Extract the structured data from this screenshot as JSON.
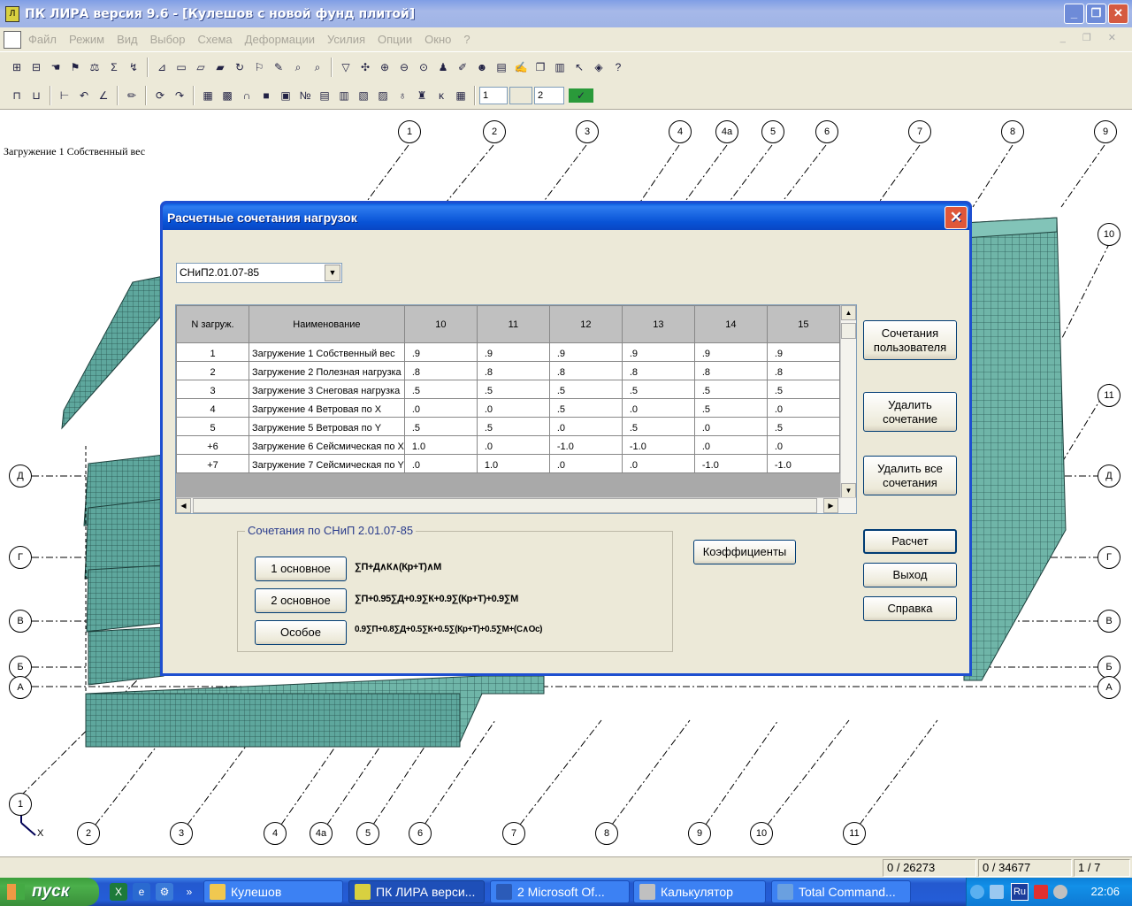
{
  "window": {
    "title": "ПК ЛИРА  версия 9.6 - [Кулешов с новой фунд плитой]",
    "min": "_",
    "max": "❐",
    "close": "✕"
  },
  "menu": {
    "items": [
      "Файл",
      "Режим",
      "Вид",
      "Выбор",
      "Схема",
      "Деформации",
      "Усилия",
      "Опции",
      "Окно",
      "?"
    ]
  },
  "toolbar": {
    "spin_value": "1",
    "spin_value2": "",
    "spin_value3": "2"
  },
  "canvas": {
    "loadcase_label": "Загружение  1 Собственный вес",
    "top_axes": [
      "1",
      "2",
      "3",
      "4",
      "4а",
      "5",
      "6",
      "7",
      "8",
      "9"
    ],
    "bottom_axes": [
      "1",
      "2",
      "3",
      "4",
      "4а",
      "5",
      "6",
      "7",
      "8",
      "9",
      "10",
      "11"
    ],
    "left_axes": [
      "Д",
      "Г",
      "В",
      "Б",
      "А"
    ],
    "right_axes": [
      "10",
      "11",
      "Д",
      "Г",
      "В",
      "Б",
      "А"
    ],
    "x_label": "X"
  },
  "dialog": {
    "title": "Расчетные сочетания нагрузок",
    "norm_select": "СНиП2.01.07-85",
    "columns": [
      "N загруж.",
      "Наименование",
      "10",
      "11",
      "12",
      "13",
      "14",
      "15"
    ],
    "rows": [
      [
        "1",
        "Загружение  1 Собственный вес",
        ".9",
        ".9",
        ".9",
        ".9",
        ".9",
        ".9"
      ],
      [
        "2",
        "Загружение  2 Полезная нагрузка",
        ".8",
        ".8",
        ".8",
        ".8",
        ".8",
        ".8"
      ],
      [
        "3",
        "Загружение  3 Снеговая нагрузка",
        ".5",
        ".5",
        ".5",
        ".5",
        ".5",
        ".5"
      ],
      [
        "4",
        "Загружение  4 Ветровая по X",
        ".0",
        ".0",
        ".5",
        ".0",
        ".5",
        ".0"
      ],
      [
        "5",
        "Загружение  5 Ветровая по Y",
        ".5",
        ".5",
        ".0",
        ".5",
        ".0",
        ".5"
      ],
      [
        "+6",
        "Загружение  6 Сейсмическая по X",
        "1.0",
        ".0",
        "-1.0",
        "-1.0",
        ".0",
        ".0"
      ],
      [
        "+7",
        "Загружение  7 Сейсмическая по Y",
        ".0",
        "1.0",
        ".0",
        ".0",
        "-1.0",
        "-1.0"
      ]
    ],
    "buttons": {
      "user_combos": "Сочетания пользователя",
      "delete_combo": "Удалить сочетание",
      "delete_all": "Удалить все сочетания",
      "calc": "Расчет",
      "exit": "Выход",
      "help": "Справка",
      "coeffs": "Коэффициенты"
    },
    "group": {
      "label": "Сочетания по СНиП 2.01.07-85",
      "basic1": "1 основное",
      "basic2": "2 основное",
      "special": "Особое",
      "formula1": "∑П+Д∧К∧(Кр+Т)∧М",
      "formula2": "∑П+0.95∑Д+0.9∑К+0.9∑(Кр+Т)+0.9∑М",
      "formula3": "0.9∑П+0.8∑Д+0.5∑К+0.5∑(Кр+Т)+0.5∑М+(С∧Ос)"
    }
  },
  "status": {
    "cell1": "0 / 26273",
    "cell2": "0 / 34677",
    "cell3": "1 / 7"
  },
  "taskbar": {
    "start": "пуск",
    "tasks": [
      "Кулешов",
      "ПК ЛИРА  верси...",
      "2 Microsoft Of...",
      "Калькулятор",
      "Total Command..."
    ],
    "lang": "Ru",
    "clock": "22:06"
  },
  "colors": {
    "mesh_fill": "#6fb5a8",
    "mesh_dark": "#4f958c",
    "title_blue": "#0a5de0",
    "face": "#ece9d8"
  }
}
